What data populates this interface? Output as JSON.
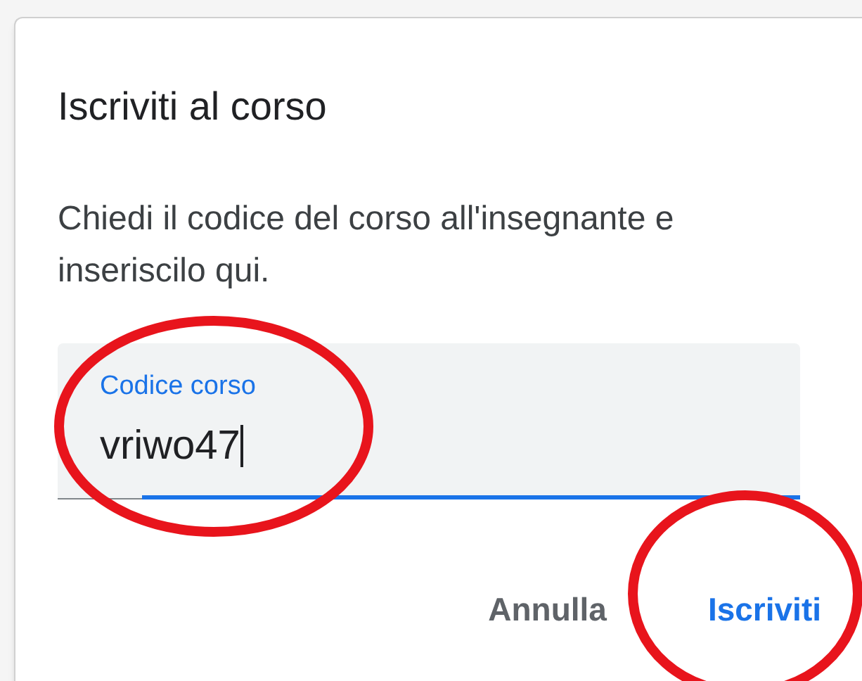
{
  "dialog": {
    "title": "Iscriviti al corso",
    "description": "Chiedi il codice del corso all'insegnante e inseriscilo qui.",
    "field": {
      "label": "Codice corso",
      "value": "vriwo47",
      "focused": true
    },
    "buttons": [
      {
        "label": "Annulla",
        "kind": "secondary"
      },
      {
        "label": "Iscriviti",
        "kind": "primary"
      }
    ]
  }
}
